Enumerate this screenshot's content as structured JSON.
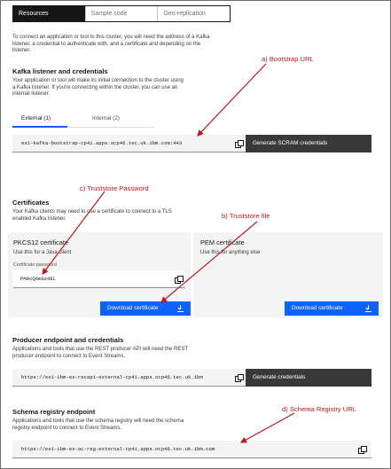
{
  "tabs": [
    {
      "label": "Resources",
      "active": true
    },
    {
      "label": "Sample code",
      "active": false
    },
    {
      "label": "Geo-replication",
      "active": false
    }
  ],
  "intro": {
    "line1": "To connect an application or tool to this cluster, you will need the address of a Kafka",
    "line2": "listener, a credential to authenticate with, and a certificate and depending on the",
    "line3": "listener."
  },
  "kafka": {
    "title": "Kafka listener and credentials",
    "line1": "Your application or tool will make its initial connection to the cluster using",
    "line2": "a Kafka listener. If you're connecting within the cluster, you can use an",
    "line3": "internal listener.",
    "tab_external": "External (1)",
    "tab_internal": "Internal (2)",
    "bootstrap_url": "es1-kafka-bootstrap-cp4i.apps.ocp46.tec.uk.ibm.com:443",
    "scram_button": "Generate SCRAM credentials"
  },
  "certificates": {
    "title": "Certificates",
    "line1": "Your Kafka clients may need to use a certificate to connect to a TLS",
    "line2": "enabled Kafka listener.",
    "pkcs12_title": "PKCS12 certificate",
    "pkcs12_desc": "Use this for a Java client",
    "password_label": "Certificate password",
    "password_value": "PM8cQ6mGzdEL",
    "download_label": "Download certificate",
    "pem_title": "PEM certificate",
    "pem_desc": "Use this for anything else",
    "pem_download_label": "Download certificate"
  },
  "producer": {
    "title": "Producer endpoint and credentials",
    "line1": "Applications and tools that use the REST producer API will need the REST",
    "line2": "producer endpoint to connect to Event Streams.",
    "url": "https://es1-ibm-es-recapi-external-cp4i.apps.ocp46.tec.uk.ibm",
    "button": "Generate credentials"
  },
  "schema": {
    "title": "Schema registry endpoint",
    "line1": "Applications and tools that use the schema registry will need the schema",
    "line2": "registry endpoint to connect to Event Streams.",
    "url": "https://es1-ibm-es-ac-reg-external-cp4i.apps.ocp46.tec.uk.ibm.com"
  },
  "annotations": {
    "a": "a) Bootstrap URL",
    "b": "b) Truststore file",
    "c": "c) Truststore Password",
    "d": "d) Schema Registry URL",
    "color": "#c0181b"
  },
  "icons": {
    "copy": "copy-icon",
    "download": "download-icon"
  }
}
